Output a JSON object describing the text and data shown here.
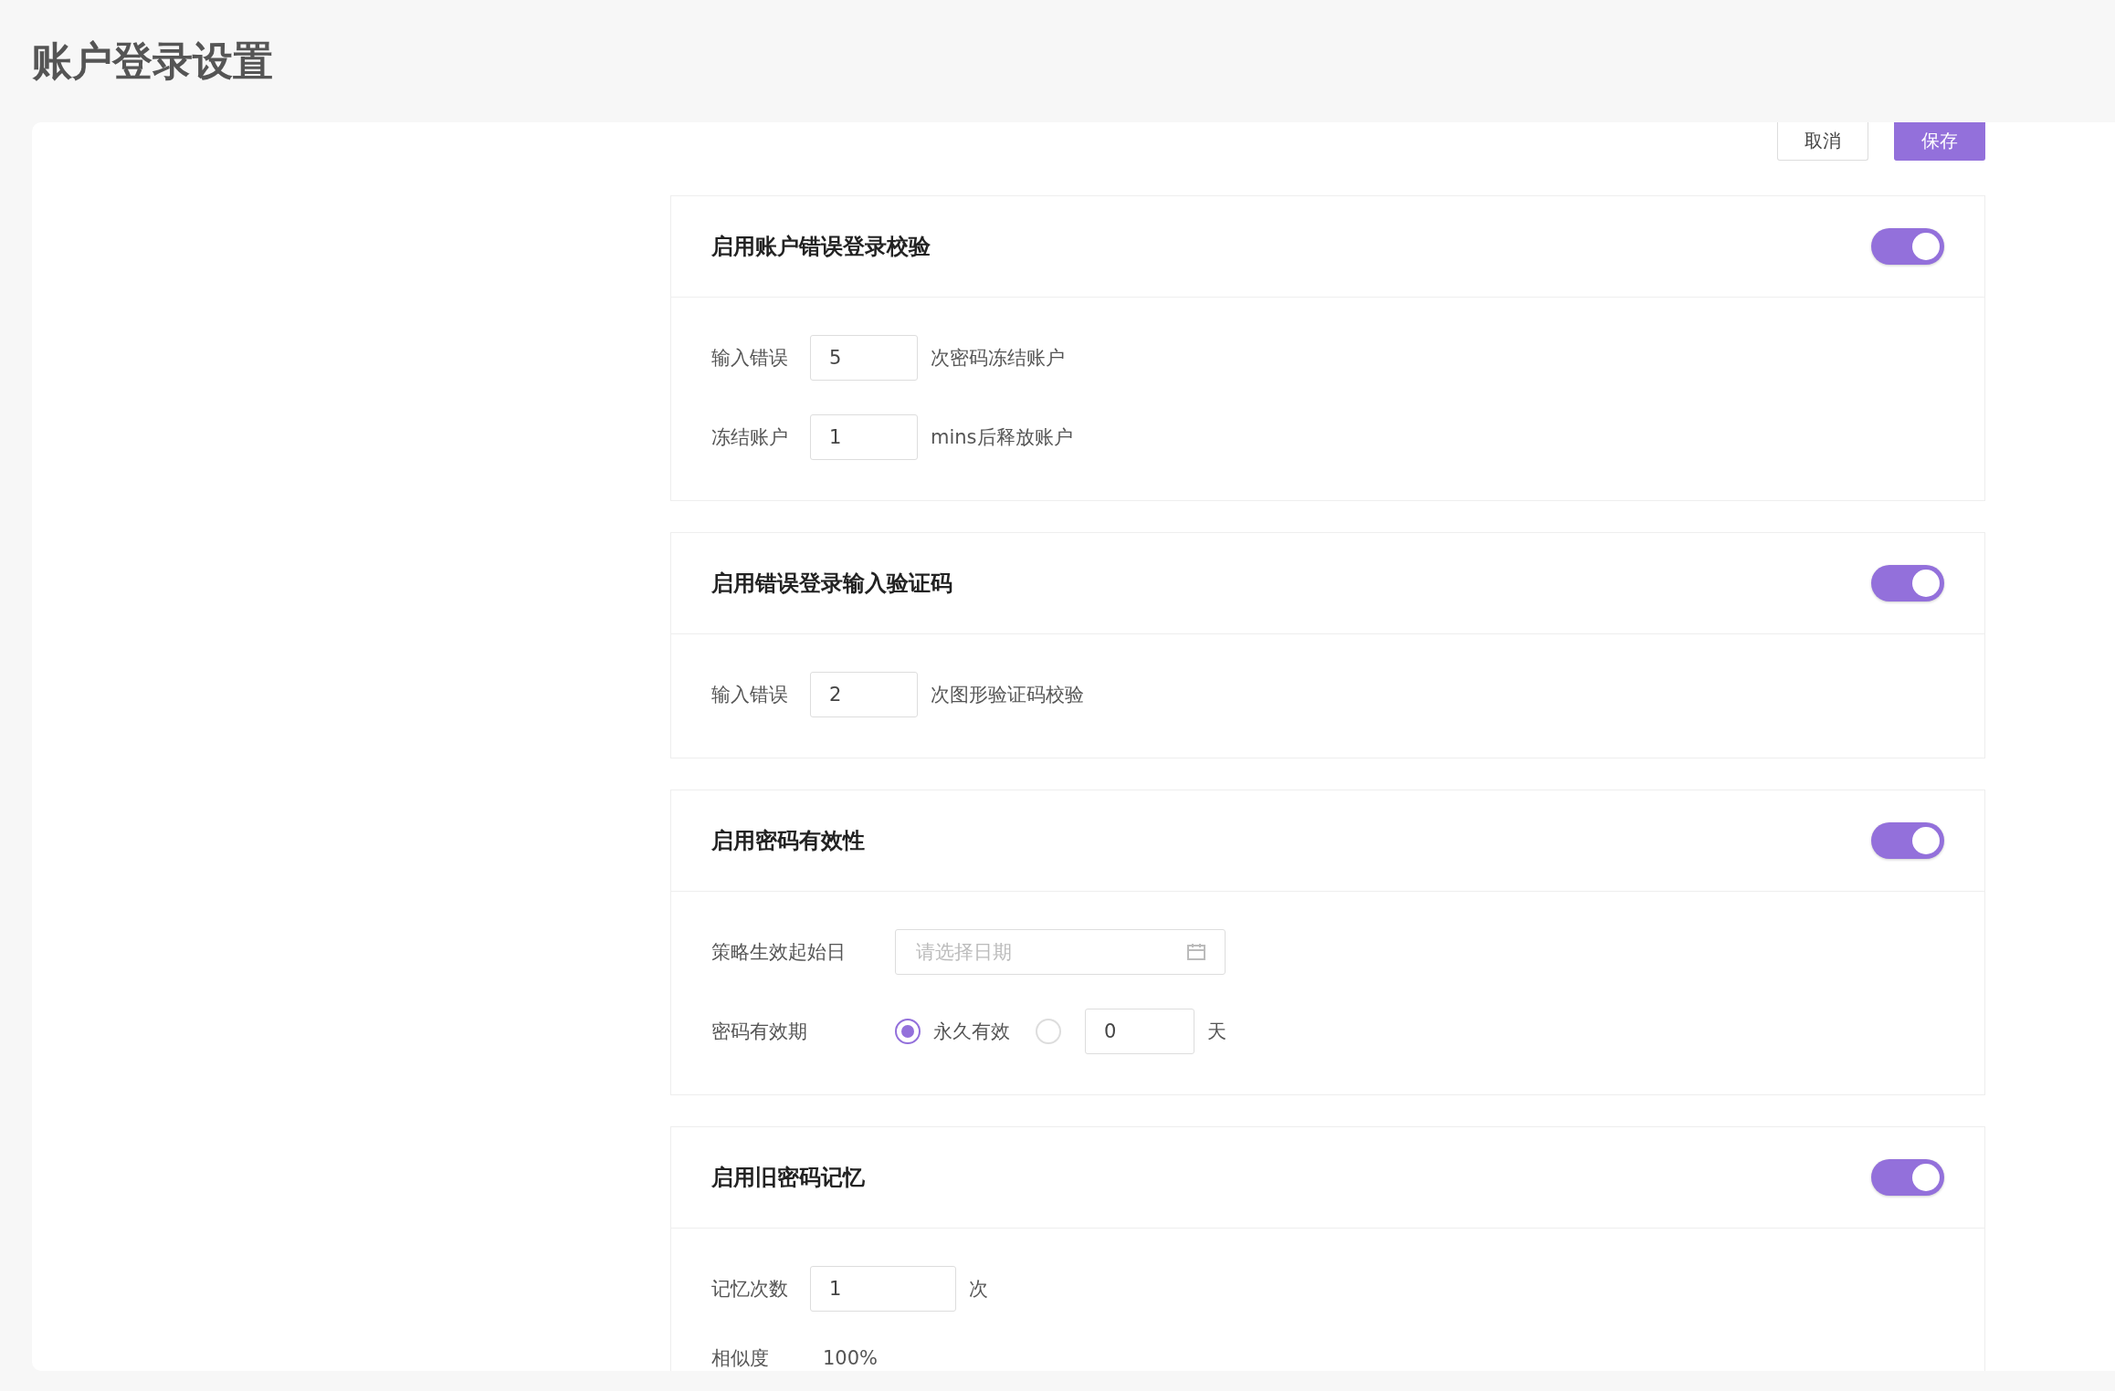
{
  "page": {
    "title": "账户登录设置"
  },
  "actions": [
    {
      "label": "取消",
      "kind": "secondary"
    },
    {
      "label": "保存",
      "kind": "primary"
    }
  ],
  "sections": [
    {
      "title": "启用账户错误登录校验",
      "on": true,
      "rows": [
        {
          "kind": "count",
          "label": "输入错误",
          "value": "5",
          "suffix": "次密码冻结账户"
        },
        {
          "kind": "count",
          "label": "冻结账户",
          "value": "1",
          "suffix": "mins后释放账户"
        }
      ]
    },
    {
      "title": "启用错误登录输入验证码",
      "on": true,
      "rows": [
        {
          "kind": "count",
          "label": "输入错误",
          "value": "2",
          "suffix": "次图形验证码校验"
        }
      ]
    },
    {
      "title": "启用密码有效性",
      "on": true,
      "rows": [
        {
          "kind": "date",
          "label": "策略生效起始日",
          "placeholder": "请选择日期"
        },
        {
          "kind": "radio",
          "label": "密码有效期",
          "options": [
            {
              "label": "永久有效",
              "selected": true
            },
            {
              "value": "0",
              "suffix": "天",
              "selected": false
            }
          ]
        }
      ]
    },
    {
      "title": "启用旧密码记忆",
      "on": true,
      "rows": [
        {
          "kind": "count",
          "label": "记忆次数",
          "value": "1",
          "suffix": "次"
        },
        {
          "kind": "text",
          "label": "相似度",
          "value": "100%"
        }
      ]
    }
  ]
}
